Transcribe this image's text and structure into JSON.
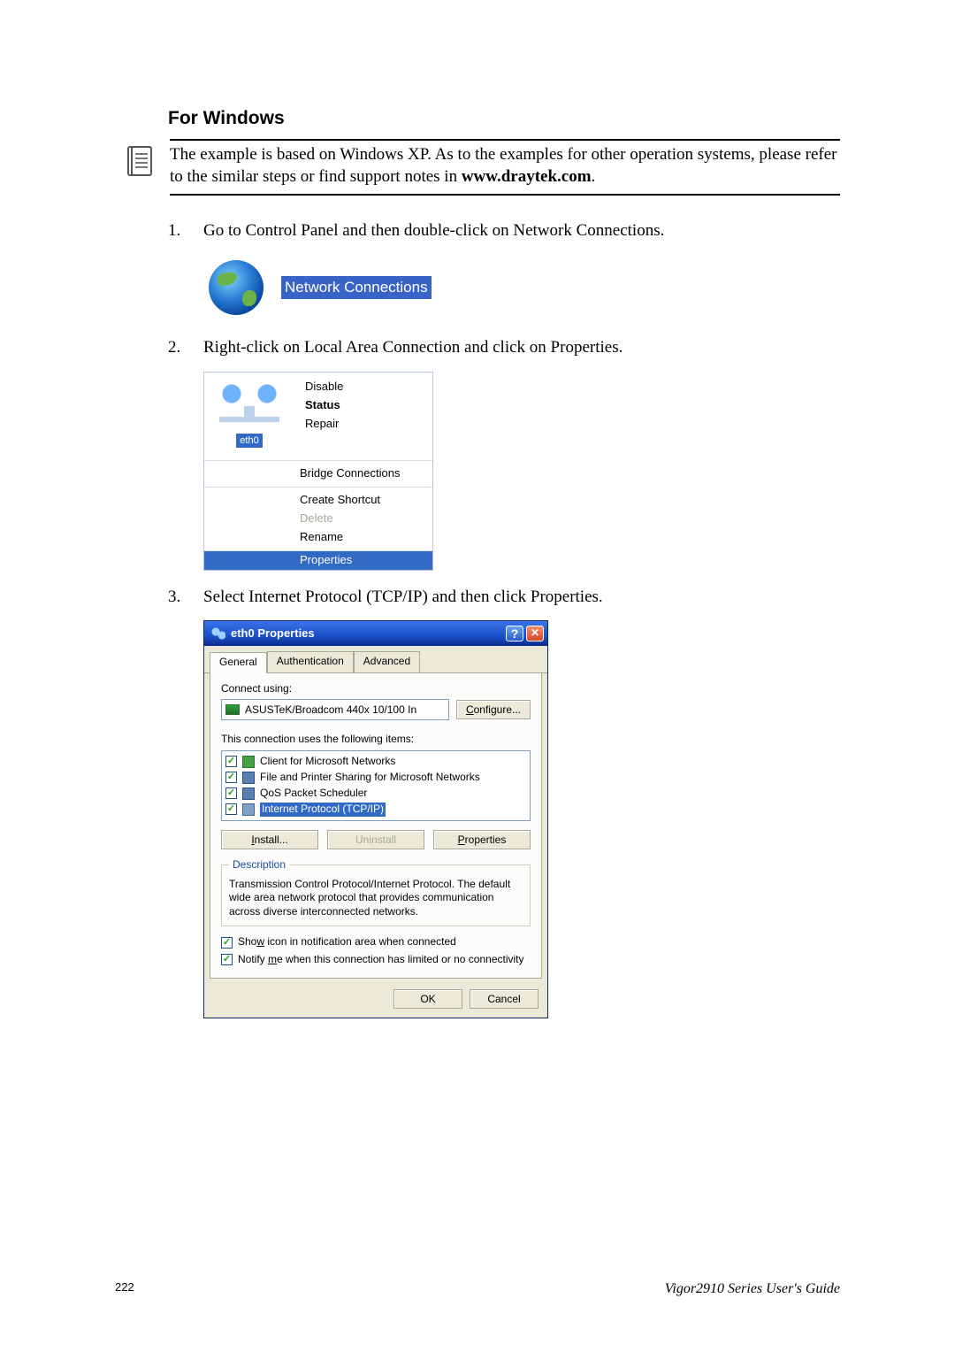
{
  "heading": "For Windows",
  "note": {
    "line1": "The example is based on Windows XP. As to the examples for other operation systems, please refer to the similar steps or find support notes in ",
    "link": "www.draytek.com",
    "tail": "."
  },
  "steps": {
    "s1": {
      "num": "1.",
      "text": "Go to Control Panel and then double-click on Network Connections."
    },
    "s2": {
      "num": "2.",
      "text": "Right-click on Local Area Connection and click on Properties."
    },
    "s3": {
      "num": "3.",
      "text": "Select Internet Protocol (TCP/IP) and then click Properties."
    }
  },
  "fig1": {
    "caption": "Network Connections"
  },
  "fig2": {
    "lan_label": "eth0",
    "menu": {
      "disable": "Disable",
      "status": "Status",
      "repair": "Repair",
      "bridge": "Bridge Connections",
      "shortcut": "Create Shortcut",
      "delete": "Delete",
      "rename": "Rename",
      "properties": "Properties"
    }
  },
  "fig3": {
    "title": "eth0 Properties",
    "tabs": {
      "general": "General",
      "auth": "Authentication",
      "advanced": "Advanced"
    },
    "connect_using": "Connect using:",
    "adapter": "ASUSTeK/Broadcom 440x 10/100 In",
    "configure": "Configure...",
    "configure_ul": "C",
    "uses_items": "This connection uses the following items:",
    "items": {
      "client": "Client for Microsoft Networks",
      "fps": "File and Printer Sharing for Microsoft Networks",
      "qos": "QoS Packet Scheduler",
      "tcpip": "Internet Protocol (TCP/IP)"
    },
    "install": "Install...",
    "install_ul": "I",
    "uninstall": "Uninstall",
    "properties": "Properties",
    "properties_ul": "P",
    "desc_legend": "Description",
    "desc_text": "Transmission Control Protocol/Internet Protocol. The default wide area network protocol that provides communication across diverse interconnected networks.",
    "show_icon": "Show icon in notification area when connected",
    "show_icon_ul": "w",
    "notify": "Notify me when this connection has limited or no connectivity",
    "notify_ul": "m",
    "ok": "OK",
    "cancel": "Cancel"
  },
  "footer": {
    "page": "222",
    "guide": "Vigor2910 Series User's Guide"
  }
}
